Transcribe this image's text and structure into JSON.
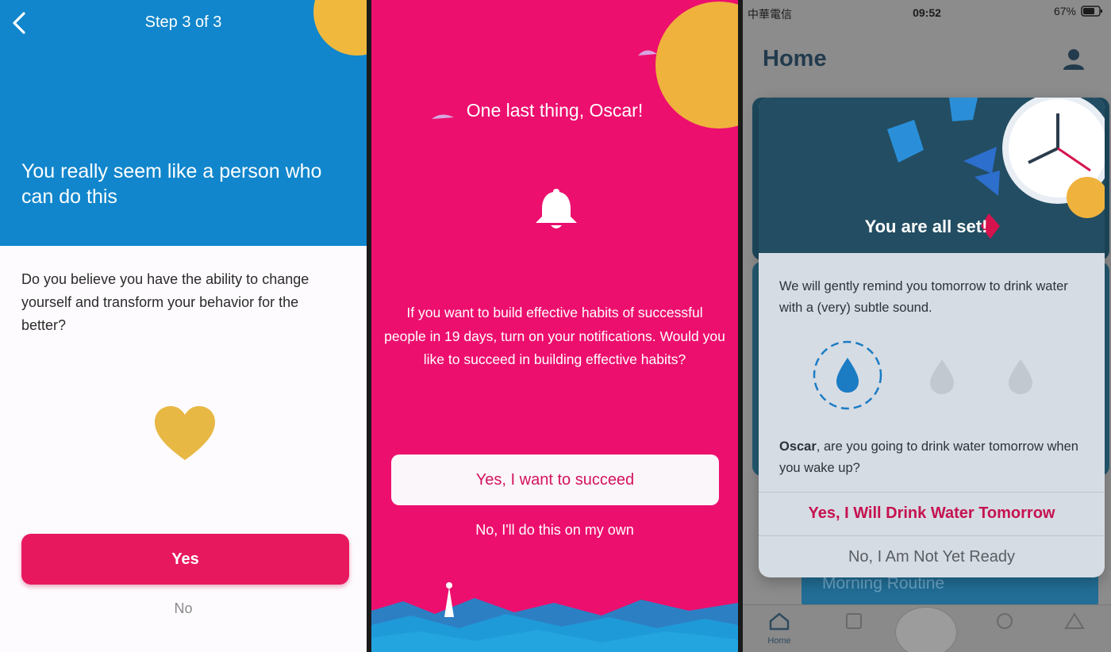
{
  "panel1": {
    "step_label": "Step 3 of 3",
    "headline": "You really seem like a person who can do this",
    "question": "Do you believe you have the ability to change yourself and transform your behavior for the better?",
    "yes_label": "Yes",
    "no_label": "No",
    "colors": {
      "header": "#1186cc",
      "accent": "#e8185f",
      "heart": "#f0b93e"
    }
  },
  "panel2": {
    "title": "One last thing, Oscar!",
    "body": "If you want to build effective habits of successful people in 19 days, turn on your notifications. Would you like to succeed in building effective habits?",
    "cta_label": "Yes, I want to succeed",
    "decline_label": "No, I'll do this on my own",
    "colors": {
      "background": "#ec0f6e",
      "sun": "#f0b93e"
    }
  },
  "panel3": {
    "status": {
      "carrier": "中華電信",
      "time": "09:52",
      "battery": "67%"
    },
    "page_title": "Home",
    "card_title": "You are all set!",
    "reminder": "We will gently remind you tomorrow to drink water with a (very) subtle sound.",
    "question_name": "Oscar",
    "question_rest": ", are you going to drink water tomorrow when you wake up?",
    "yes_label": "Yes, I Will Drink Water Tomorrow",
    "no_label": "No, I Am Not Yet Ready",
    "behind_card_label": "Morning Routine",
    "tabs": [
      {
        "label": "Home",
        "icon": "home-icon"
      }
    ],
    "colors": {
      "accent": "#c5124f",
      "drop_active": "#1b7cc4"
    }
  }
}
